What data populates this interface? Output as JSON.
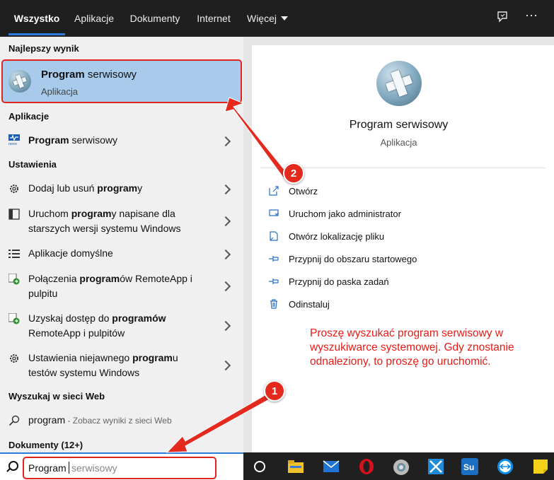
{
  "tabs": [
    {
      "label": "Wszystko"
    },
    {
      "label": "Aplikacje"
    },
    {
      "label": "Dokumenty"
    },
    {
      "label": "Internet"
    },
    {
      "label": "Więcej"
    }
  ],
  "top_icons": {
    "feedback": "feedback-icon",
    "more": "⋯"
  },
  "best_match": {
    "section": "Najlepszy wynik",
    "title_bold": "Program",
    "title_rest": " serwisowy",
    "subtitle": "Aplikacja"
  },
  "apps": {
    "section": "Aplikacje",
    "items": [
      {
        "bold": "Program",
        "rest": " serwisowy"
      }
    ]
  },
  "settings": {
    "section": "Ustawienia",
    "items": [
      {
        "pre": "Dodaj lub usuń ",
        "bold": "program",
        "post": "y"
      },
      {
        "pre": "Uruchom ",
        "bold": "program",
        "post": "y napisane dla starszych wersji systemu Windows"
      },
      {
        "pre": "Aplikacje domyślne",
        "bold": "",
        "post": ""
      },
      {
        "pre": "Połączenia ",
        "bold": "program",
        "post": "ów RemoteApp i pulpitu"
      },
      {
        "pre": "Uzyskaj dostęp do ",
        "bold": "programów",
        "post": " RemoteApp i pulpitów"
      },
      {
        "pre": "Ustawienia niejawnego ",
        "bold": "program",
        "post": "u testów systemu Windows"
      }
    ]
  },
  "web": {
    "section": "Wyszukaj w sieci Web",
    "query": "program",
    "hint": " - Zobacz wyniki z sieci Web"
  },
  "documents": {
    "section": "Dokumenty (12+)"
  },
  "detail": {
    "name": "Program serwisowy",
    "kind": "Aplikacja",
    "actions": [
      {
        "label": "Otwórz",
        "icon": "open-icon"
      },
      {
        "label": "Uruchom jako administrator",
        "icon": "admin-icon"
      },
      {
        "label": "Otwórz lokalizację pliku",
        "icon": "file-location-icon"
      },
      {
        "label": "Przypnij do obszaru startowego",
        "icon": "pin-icon"
      },
      {
        "label": "Przypnij do paska zadań",
        "icon": "pin-icon"
      },
      {
        "label": "Odinstaluj",
        "icon": "trash-icon"
      }
    ]
  },
  "note": "Proszę wyszukać program serwisowy w wyszukiwarce systemowej. Gdy znostanie odnaleziony, to proszę go uruchomić.",
  "search": {
    "typed": "Program",
    "ghost": "serwisowy"
  },
  "badges": {
    "first": "1",
    "second": "2"
  },
  "taskbar_icons": [
    "cortana-icon",
    "file-explorer-icon",
    "mail-icon",
    "opera-icon",
    "chrome-style-icon",
    "visual-studio-icon",
    "sumatra-icon",
    "teamviewer-icon",
    "sticky-notes-icon"
  ],
  "colors": {
    "accent": "#2a7dd8",
    "highlight": "#a8cbec",
    "annotation_red": "#e42a1f"
  }
}
